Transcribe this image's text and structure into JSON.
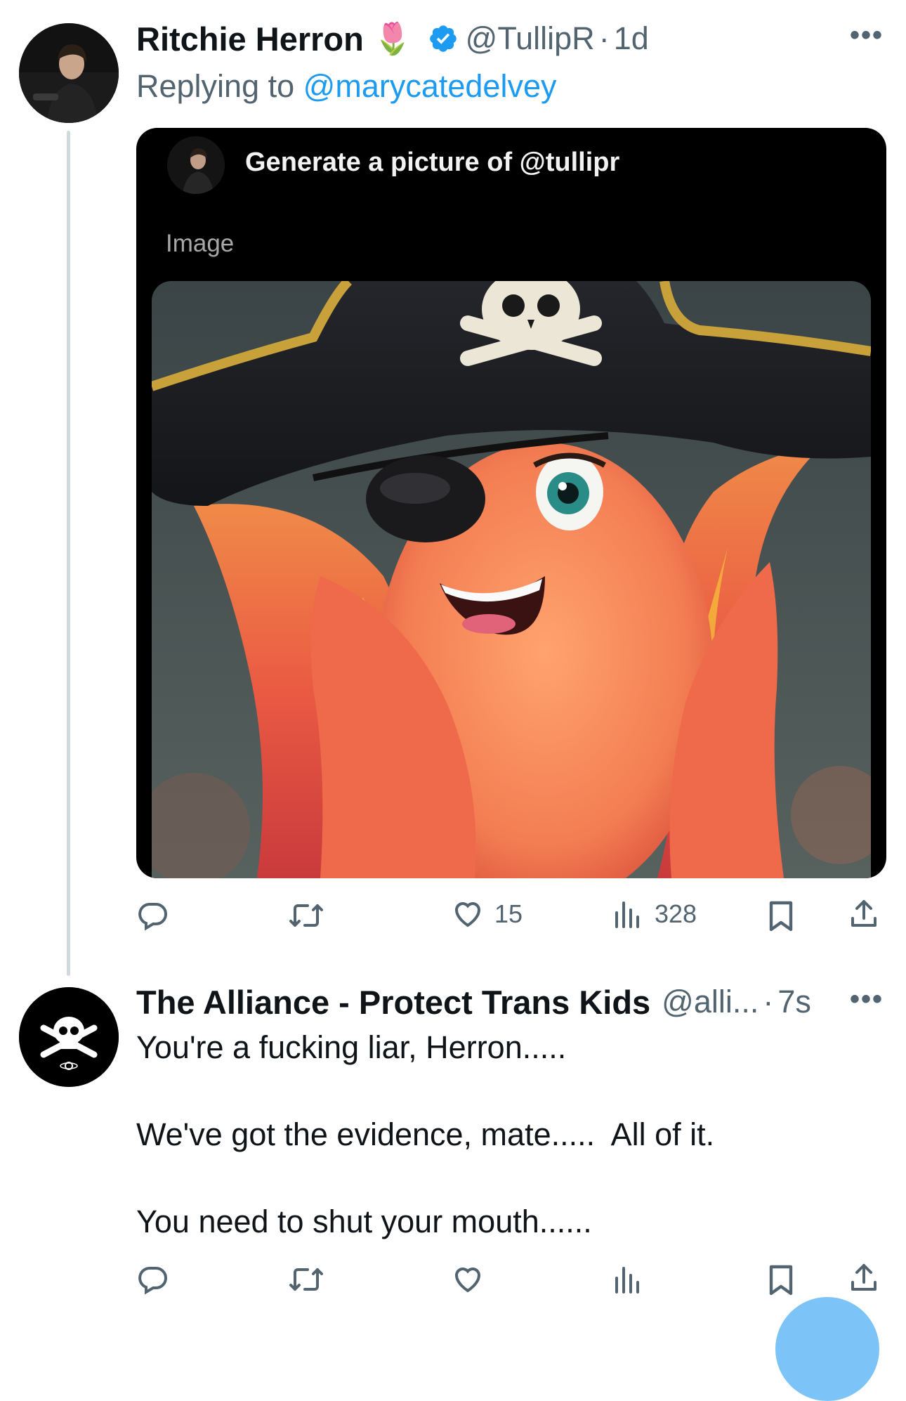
{
  "tweet1": {
    "display_name": "Ritchie Herron",
    "name_emoji": "🌷",
    "verified": true,
    "handle": "@TullipR",
    "separator": "·",
    "time": "1d",
    "replying_prefix": "Replying to",
    "replying_to": "@marycatedelvey",
    "card": {
      "prompt": "Generate a picture of @tullipr",
      "label": "Image"
    },
    "stats": {
      "likes": "15",
      "views": "328"
    }
  },
  "tweet2": {
    "display_name": "The Alliance - Protect Trans Kids",
    "handle": "@alli...",
    "separator": "·",
    "time": "7s",
    "text": "You're a fucking liar, Herron.....\n\nWe've got the evidence, mate.....  All of it.\n\nYou need to shut your mouth......"
  },
  "colors": {
    "accent": "#1d9bf0",
    "muted": "#536471",
    "text": "#0f1419",
    "thread_line": "#cfd9de"
  },
  "icons": [
    "more-icon",
    "verified-icon",
    "reply-icon",
    "retweet-icon",
    "like-icon",
    "views-icon",
    "bookmark-icon",
    "share-icon",
    "skull-crossbones-icon"
  ]
}
